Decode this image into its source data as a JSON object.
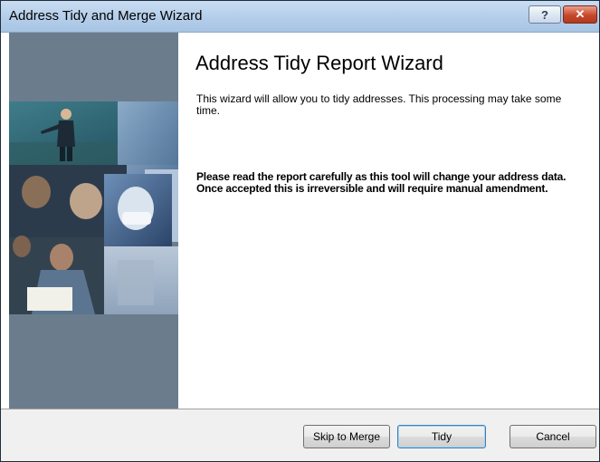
{
  "window": {
    "title": "Address Tidy and Merge Wizard",
    "help_glyph": "?",
    "close_glyph": "✕"
  },
  "wizard": {
    "heading": "Address Tidy Report Wizard",
    "intro": "This wizard will allow you to tidy addresses. This processing may take some time.",
    "warning": "Please read the report carefully as this tool will change your address data. Once accepted this is irreversible and will require manual amendment."
  },
  "buttons": {
    "skip_label": "Skip to Merge",
    "tidy_label": "Tidy",
    "cancel_label": "Cancel"
  },
  "colors": {
    "side_panel": "#6b7d8d",
    "title_bar": "#b5cfea",
    "footer": "#f0f0f0"
  }
}
